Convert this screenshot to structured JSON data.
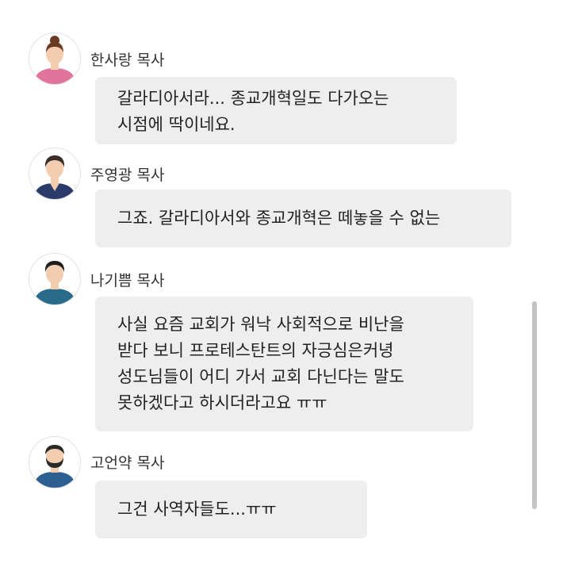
{
  "messages": [
    {
      "sender": "한사랑 목사",
      "avatar_icon": "female-avatar-icon",
      "lines": [
        "갈라디아서라... 종교개혁일도 다가오는",
        "시점에 딱이네요."
      ]
    },
    {
      "sender": "주영광 목사",
      "avatar_icon": "male-avatar-icon",
      "lines": [
        "그죠. 갈라디아서와 종교개혁은 떼놓을 수 없는"
      ]
    },
    {
      "sender": "나기쁨 목사",
      "avatar_icon": "male-avatar-icon",
      "lines": [
        "사실 요즘 교회가 워낙 사회적으로 비난을",
        "받다 보니 프로테스탄트의 자긍심은커녕",
        "성도님들이 어디 가서 교회 다닌다는 말도",
        "못하겠다고 하시더라고요 ㅠㅠ"
      ]
    },
    {
      "sender": "고언약 목사",
      "avatar_icon": "bearded-male-avatar-icon",
      "lines": [
        "그건 사역자들도...ㅠㅠ"
      ]
    }
  ],
  "colors": {
    "bubble": "#eeeeee",
    "text": "#222222",
    "name": "#333333",
    "female_shirt": "#e0749a",
    "male_shirt_dark": "#2a3a6a",
    "male_shirt_teal": "#2a6a8a",
    "male_shirt_blue": "#2d5f92",
    "skin": "#f3cdb0",
    "hair_brown": "#6b3a25",
    "hair_dark": "#3b2e28",
    "hair_black": "#1e1e1e"
  }
}
